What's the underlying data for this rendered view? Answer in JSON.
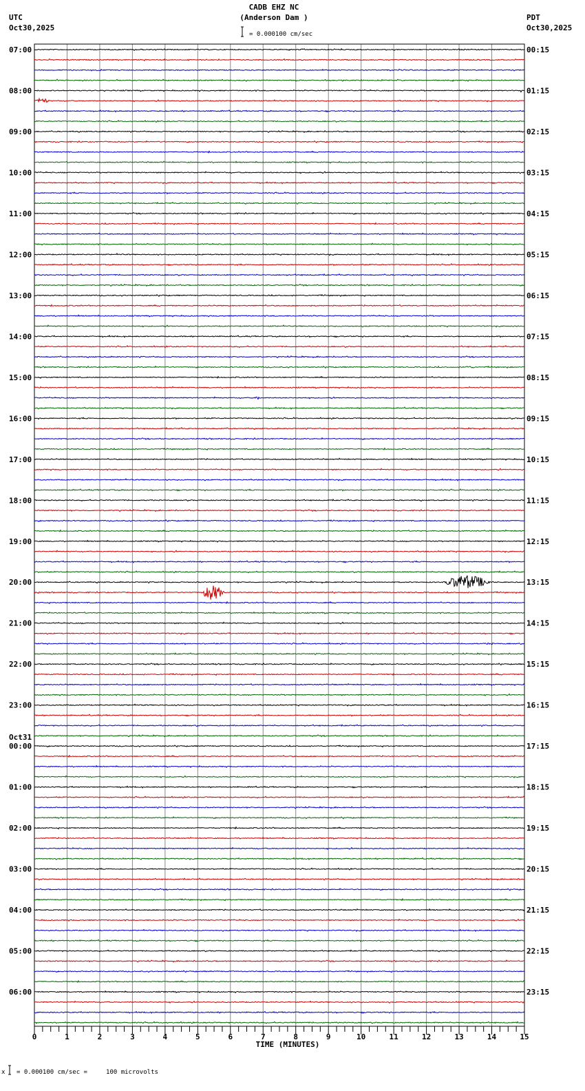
{
  "header": {
    "station": "CADB EHZ NC",
    "site": "(Anderson Dam )",
    "left_tz": "UTC",
    "left_date": "Oct30,2025",
    "right_tz": "PDT",
    "right_date": "Oct30,2025",
    "scale_text": "= 0.000100 cm/sec"
  },
  "footer": {
    "scale_text": "= 0.000100 cm/sec =     100 microvolts",
    "prefix": "x"
  },
  "chart_data": {
    "type": "line",
    "title": "CADB EHZ NC (Anderson Dam )",
    "xlabel": "TIME (MINUTES)",
    "xlim": [
      0,
      15
    ],
    "x_ticks": [
      "0",
      "1",
      "2",
      "3",
      "4",
      "5",
      "6",
      "7",
      "8",
      "9",
      "10",
      "11",
      "12",
      "13",
      "14",
      "15"
    ],
    "traces_per_hour": 4,
    "minutes_per_trace": 15,
    "trace_colors": [
      "#000000",
      "#cc0000",
      "#0000cc",
      "#006600"
    ],
    "left_labels": [
      "07:00",
      "08:00",
      "09:00",
      "10:00",
      "11:00",
      "12:00",
      "13:00",
      "14:00",
      "15:00",
      "16:00",
      "17:00",
      "18:00",
      "19:00",
      "20:00",
      "21:00",
      "22:00",
      "23:00",
      "00:00",
      "01:00",
      "02:00",
      "03:00",
      "04:00",
      "05:00",
      "06:00"
    ],
    "date_change_label": "Oct31",
    "date_change_hour_index": 17,
    "right_labels": [
      "00:15",
      "01:15",
      "02:15",
      "03:15",
      "04:15",
      "05:15",
      "06:15",
      "07:15",
      "08:15",
      "09:15",
      "10:15",
      "11:15",
      "12:15",
      "13:15",
      "14:15",
      "15:15",
      "16:15",
      "17:15",
      "18:15",
      "19:15",
      "20:15",
      "21:15",
      "22:15",
      "23:15"
    ],
    "events": [
      {
        "trace": 4,
        "start_min": 14.85,
        "end_min": 15.0,
        "amplitude": 4
      },
      {
        "trace": 5,
        "start_min": 0.0,
        "end_min": 0.8,
        "amplitude": 5
      },
      {
        "trace": 31,
        "start_min": 13.0,
        "end_min": 14.0,
        "amplitude": 2
      },
      {
        "trace": 34,
        "start_min": 6.75,
        "end_min": 7.0,
        "amplitude": 4
      },
      {
        "trace": 52,
        "start_min": 12.5,
        "end_min": 15.0,
        "amplitude": 13
      },
      {
        "trace": 53,
        "start_min": 0.05,
        "end_min": 0.2,
        "amplitude": 5
      },
      {
        "trace": 53,
        "start_min": 5.1,
        "end_min": 6.3,
        "amplitude": 14
      },
      {
        "trace": 58,
        "start_min": 13.8,
        "end_min": 14.3,
        "amplitude": 2
      }
    ]
  }
}
